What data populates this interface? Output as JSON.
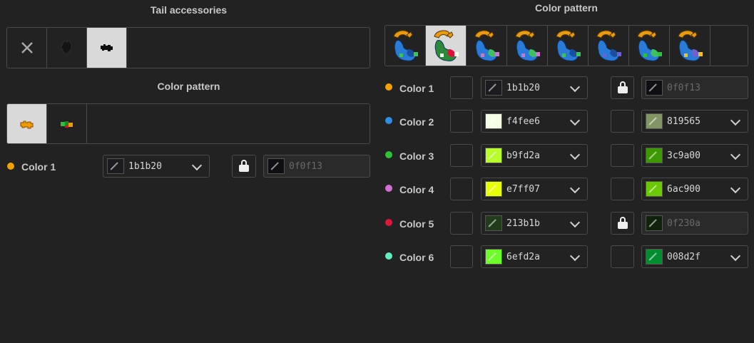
{
  "left": {
    "tail_title": "Tail accessories",
    "pattern_title": "Color pattern",
    "color1": {
      "label": "Color 1",
      "dot": "#f5a000",
      "hex": "1b1b20",
      "swatch": "#1b1b20",
      "locked_hex": "0f0f13",
      "locked_swatch": "#0f0f13"
    }
  },
  "right": {
    "pattern_title": "Color pattern",
    "colors": [
      {
        "label": "Color 1",
        "dot": "#f5a000",
        "hex": "1b1b20",
        "swatch": "#1b1b20",
        "hex2": "0f0f13",
        "swatch2": "#0f0f13",
        "locked": true
      },
      {
        "label": "Color 2",
        "dot": "#2f8de4",
        "hex": "f4fee6",
        "swatch": "#f4fee6",
        "hex2": "819565",
        "swatch2": "#819565",
        "locked": false
      },
      {
        "label": "Color 3",
        "dot": "#2ec23a",
        "hex": "b9fd2a",
        "swatch": "#b9fd2a",
        "hex2": "3c9a00",
        "swatch2": "#3c9a00",
        "locked": false
      },
      {
        "label": "Color 4",
        "dot": "#d070d0",
        "hex": "e7ff07",
        "swatch": "#e7ff07",
        "hex2": "6ac900",
        "swatch2": "#6ac900",
        "locked": false
      },
      {
        "label": "Color 5",
        "dot": "#e0163c",
        "hex": "213b1b",
        "swatch": "#213b1b",
        "hex2": "0f230a",
        "swatch2": "#0f230a",
        "locked": true
      },
      {
        "label": "Color 6",
        "dot": "#60f0c0",
        "hex": "6efd2a",
        "swatch": "#6efd2a",
        "hex2": "008d2f",
        "swatch2": "#008d2f",
        "locked": false
      }
    ]
  },
  "icons": {
    "none": "close-icon",
    "tail_dark": "tail-accessory-dark-icon",
    "tail_black": "tail-accessory-black-icon",
    "pattern_orange": "pattern-orange-icon",
    "pattern_multi": "pattern-multicolor-icon",
    "lock": "lock-icon",
    "chevron": "chevron-down-icon"
  }
}
